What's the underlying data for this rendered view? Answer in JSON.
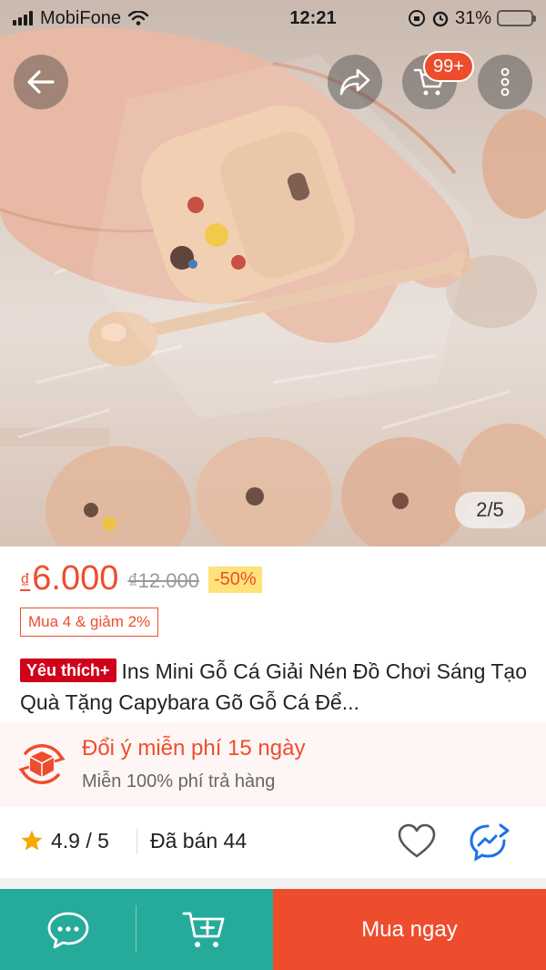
{
  "status_bar": {
    "carrier": "MobiFone",
    "time": "12:21",
    "battery": "31%",
    "battery_level": 0.31
  },
  "nav": {
    "back_icon": "arrow-left-icon",
    "share_icon": "share-icon",
    "cart_icon": "cart-icon",
    "cart_badge": "99+",
    "more_icon": "more-vertical-icon"
  },
  "gallery": {
    "counter": "2/5"
  },
  "product": {
    "currency": "₫",
    "price": "6.000",
    "old_price": "₫12.000",
    "discount": "-50%",
    "bundle_deal": "Mua 4 & giảm 2%",
    "favorite_badge": "Yêu thích+",
    "title": "Ins Mini Gỗ Cá Giải Nén Đồ Chơi Sáng Tạo Quà Tặng Capybara Gõ Gỗ Cá Để..."
  },
  "return_policy": {
    "title": "Đổi ý miễn phí 15 ngày",
    "subtitle": "Miễn 100% phí trả hàng"
  },
  "stats": {
    "rating": "4.9 / 5",
    "sold": "Đã bán 44"
  },
  "bottom_bar": {
    "chat_icon": "chat-icon",
    "add_to_cart_icon": "add-to-cart-icon",
    "buy_now": "Mua ngay"
  },
  "colors": {
    "brand": "#ee4d2d",
    "teal": "#26ab9a",
    "favorite_red": "#d0011b",
    "discount_bg": "#ffe27a",
    "policy_bg": "#fef6f5"
  }
}
